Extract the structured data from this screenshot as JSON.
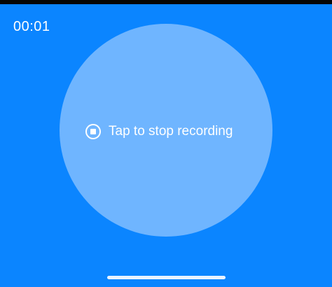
{
  "recorder": {
    "elapsed_time": "00:01",
    "stop_prompt": "Tap to stop recording",
    "stop_icon": "stop-circle-icon"
  },
  "colors": {
    "background": "#0b85ff",
    "circle": "#6fb5ff",
    "foreground": "#ffffff"
  }
}
